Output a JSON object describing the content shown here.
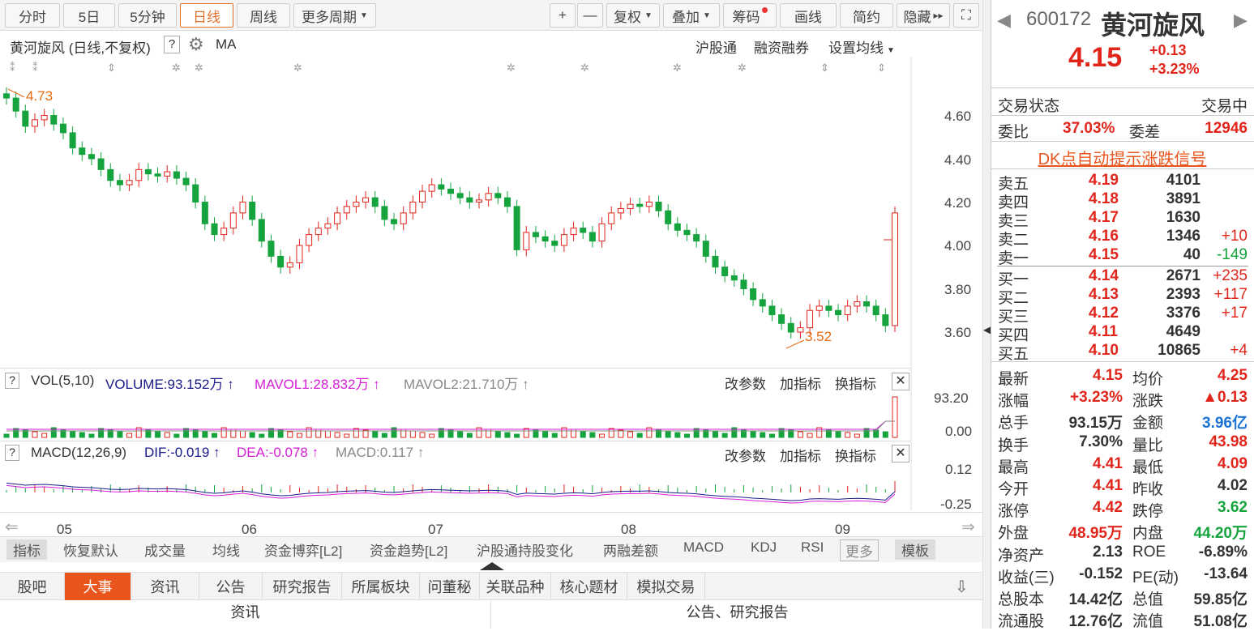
{
  "toolbar": {
    "items": [
      "分时",
      "5日",
      "5分钟",
      "日线",
      "周线",
      "更多周期"
    ],
    "active": "日线",
    "right": [
      "+",
      "—",
      "复权",
      "叠加",
      "筹码",
      "画线",
      "简约",
      "隐藏"
    ]
  },
  "chart_header": {
    "title": "黄河旋风 (日线,不复权)",
    "help": "?",
    "ma": "MA",
    "links": [
      "沪股通",
      "融资融券",
      "设置均线"
    ]
  },
  "price_axis": [
    "4.60",
    "4.40",
    "4.20",
    "4.00",
    "3.80",
    "3.60"
  ],
  "annotations": {
    "high": "4.73",
    "low": "3.52"
  },
  "vol_header": {
    "label": "VOL(5,10)",
    "volume": "VOLUME:93.152万",
    "mavol1": "MAVOL1:28.832万",
    "mavol2": "MAVOL2:21.710万",
    "actions": [
      "改参数",
      "加指标",
      "换指标"
    ]
  },
  "vol_axis": [
    "93.20",
    "0.00"
  ],
  "macd_header": {
    "label": "MACD(12,26,9)",
    "dif": "DIF:-0.019",
    "dea": "DEA:-0.078",
    "macd": "MACD:0.117",
    "actions": [
      "改参数",
      "加指标",
      "换指标"
    ]
  },
  "macd_axis": [
    "0.12",
    "-0.25"
  ],
  "date_axis": [
    "05",
    "06",
    "07",
    "08",
    "09"
  ],
  "indicators": {
    "items": [
      "指标",
      "恢复默认",
      "成交量",
      "均线",
      "资金博弈[L2]",
      "资金趋势[L2]",
      "沪股通持股变化",
      "两融差额",
      "MACD",
      "KDJ",
      "RSI",
      "更多",
      "模板"
    ]
  },
  "bottom_tabs": [
    "股吧",
    "大事",
    "资讯",
    "公告",
    "研究报告",
    "所属板块",
    "问董秘",
    "关联品种",
    "核心题材",
    "模拟交易"
  ],
  "active_tab": "大事",
  "sub_headers": [
    "资讯",
    "公告、研究报告"
  ],
  "quote": {
    "code": "600172",
    "name": "黄河旋风",
    "price": "4.15",
    "change": "+0.13",
    "pct": "+3.23%"
  },
  "status": {
    "label": "交易状态",
    "value": "交易中"
  },
  "ratio": {
    "wb_label": "委比",
    "wb": "37.03%",
    "wc_label": "委差",
    "wc": "12946"
  },
  "signal": "DK点自动提示涨跌信号",
  "asks": [
    {
      "l": "卖五",
      "p": "4.19",
      "v": "4101",
      "c": ""
    },
    {
      "l": "卖四",
      "p": "4.18",
      "v": "3891",
      "c": ""
    },
    {
      "l": "卖三",
      "p": "4.17",
      "v": "1630",
      "c": ""
    },
    {
      "l": "卖二",
      "p": "4.16",
      "v": "1346",
      "c": "+10"
    },
    {
      "l": "卖一",
      "p": "4.15",
      "v": "40",
      "c": "-149"
    }
  ],
  "bids": [
    {
      "l": "买一",
      "p": "4.14",
      "v": "2671",
      "c": "+235"
    },
    {
      "l": "买二",
      "p": "4.13",
      "v": "2393",
      "c": "+117"
    },
    {
      "l": "买三",
      "p": "4.12",
      "v": "3376",
      "c": "+17"
    },
    {
      "l": "买四",
      "p": "4.11",
      "v": "4649",
      "c": ""
    },
    {
      "l": "买五",
      "p": "4.10",
      "v": "10865",
      "c": "+4"
    }
  ],
  "stats": [
    {
      "l1": "最新",
      "v1": "4.15",
      "l2": "均价",
      "v2": "4.25"
    },
    {
      "l1": "涨幅",
      "v1": "+3.23%",
      "l2": "涨跌",
      "v2": "▲0.13"
    },
    {
      "l1": "总手",
      "v1": "93.15万",
      "l2": "金额",
      "v2": "3.96亿"
    },
    {
      "l1": "换手",
      "v1": "7.30%",
      "l2": "量比",
      "v2": "43.98"
    },
    {
      "l1": "最高",
      "v1": "4.41",
      "l2": "最低",
      "v2": "4.09"
    },
    {
      "l1": "今开",
      "v1": "4.41",
      "l2": "昨收",
      "v2": "4.02"
    },
    {
      "l1": "涨停",
      "v1": "4.42",
      "l2": "跌停",
      "v2": "3.62"
    },
    {
      "l1": "外盘",
      "v1": "48.95万",
      "l2": "内盘",
      "v2": "44.20万"
    },
    {
      "l1": "净资产",
      "v1": "2.13",
      "l2": "ROE",
      "v2": "-6.89%"
    },
    {
      "l1": "收益(三)",
      "v1": "-0.152",
      "l2": "PE(动)",
      "v2": "-13.64"
    },
    {
      "l1": "总股本",
      "v1": "14.42亿",
      "l2": "总值",
      "v2": "59.85亿"
    },
    {
      "l1": "流通股",
      "v1": "12.76亿",
      "l2": "流值",
      "v2": "51.08亿"
    }
  ],
  "colors": {
    "up": "#e1251b",
    "down": "#14a33d",
    "accent": "#e8561d"
  }
}
